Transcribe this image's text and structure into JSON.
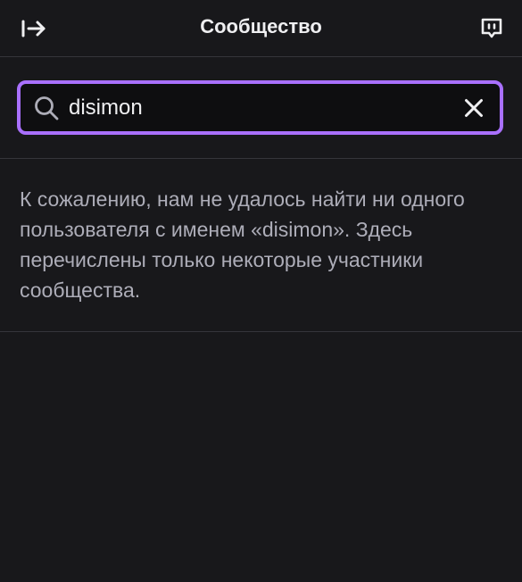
{
  "header": {
    "title": "Сообщество",
    "collapse_icon": "arrow-right-from-line-icon",
    "chat_icon": "chat-bubble-icon"
  },
  "search": {
    "value": "disimon",
    "search_icon": "search-icon",
    "clear_icon": "close-icon",
    "focus_color": "#a970ff"
  },
  "results": {
    "message": "К сожалению, нам не удалось найти ни одного пользователя с именем «disimon». Здесь перечислены только некоторые участники сообщества."
  },
  "theme": {
    "background": "#18181b",
    "text_primary": "#efeff1",
    "text_secondary": "#adadb8",
    "accent": "#a970ff"
  }
}
